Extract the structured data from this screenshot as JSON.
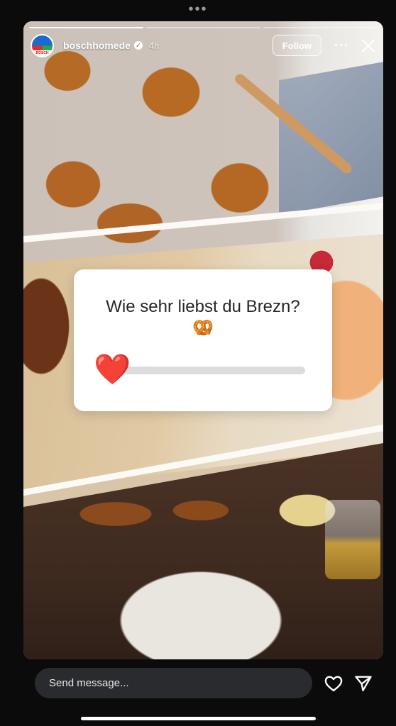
{
  "story": {
    "progress_segments": [
      1.0,
      0.0,
      0.0
    ]
  },
  "header": {
    "avatar_label": "BOSCH",
    "username": "boschhomede",
    "time": "4h",
    "follow_label": "Follow"
  },
  "poll": {
    "question": "Wie sehr liebst du Brezn? 🥨",
    "emoji": "❤️"
  },
  "footer": {
    "message_placeholder": "Send message..."
  }
}
